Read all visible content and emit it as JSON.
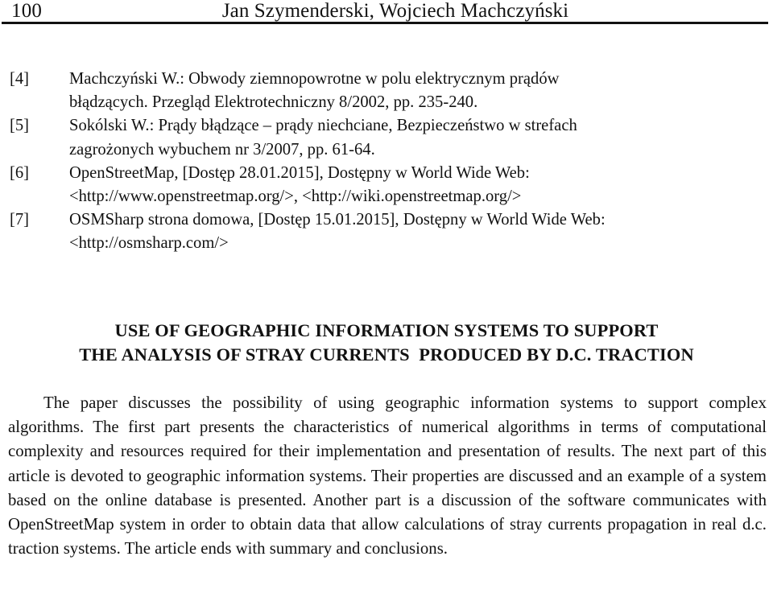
{
  "header": {
    "folio": "100",
    "authors": "Jan Szymenderski, Wojciech Machczyński"
  },
  "references": [
    {
      "tag": "[4]",
      "line1": "Machczyński W.: Obwody ziemnopowrotne w polu elektrycznym prądów",
      "line2": "błądzących. Przegląd Elektrotechniczny 8/2002, pp. 235-240."
    },
    {
      "tag": "[5]",
      "line1": "Sokólski W.: Prądy błądzące – prądy niechciane, Bezpieczeństwo w strefach",
      "line2": "zagrożonych wybuchem nr 3/2007, pp. 61-64."
    },
    {
      "tag": "[6]",
      "line1": "OpenStreetMap, [Dostęp 28.01.2015], Dostępny w World Wide Web:",
      "line2": "<http://www.openstreetmap.org/>, <http://wiki.openstreetmap.org/>"
    },
    {
      "tag": "[7]",
      "line1": "OSMSharp strona domowa, [Dostęp 15.01.2015], Dostępny w World Wide Web:",
      "line2": "<http://osmsharp.com/>"
    }
  ],
  "title": {
    "line1": "USE OF GEOGRAPHIC INFORMATION SYSTEMS TO SUPPORT",
    "line2": "THE ANALYSIS OF STRAY CURRENTS  PRODUCED BY D.C. TRACTION"
  },
  "abstract": {
    "text": "The paper discusses the possibility of using geographic information systems to support complex algorithms. The first part presents the characteristics of numerical algorithms in terms of computational complexity and resources required for their implementation and presentation of results. The next part of this article is devoted to geographic information systems. Their properties are discussed and an example of a system based on the online database is presented. Another part is a discussion of the software communicates with OpenStreetMap system in order to obtain data that allow calculations of stray currents propagation in real d.c.  traction systems. The article ends with summary and conclusions."
  }
}
